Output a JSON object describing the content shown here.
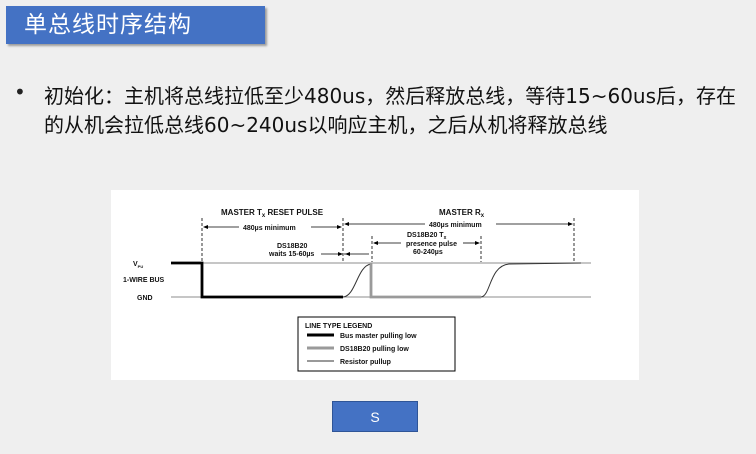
{
  "slide": {
    "title": "单总线时序结构",
    "bullet": "初始化：主机将总线拉低至少480us，然后释放总线，等待15~60us后，存在的从机会拉低总线60~240us以响应主机，之后从机将释放总线"
  },
  "diagram": {
    "master_tx_label": "MASTER T",
    "master_tx_sub": "x",
    "master_tx_suffix": " RESET PULSE",
    "master_tx_min": "480µs minimum",
    "master_rx_label": "MASTER R",
    "master_rx_sub": "x",
    "master_rx_min": "480µs minimum",
    "ds_wait_1": "DS18B20",
    "ds_wait_2": "waits 15-60µs",
    "ds_tx_label": "DS18B20 T",
    "ds_tx_sub": "x",
    "ds_presence_1": "presence pulse",
    "ds_presence_2": "60-240µs",
    "vpu_label": "V",
    "vpu_sub": "PU",
    "bus_label": "1-WIRE BUS",
    "gnd_label": "GND",
    "legend_title": "LINE TYPE LEGEND",
    "legend_items": [
      "Bus master pulling low",
      "DS18B20 pulling low",
      "Resistor pullup"
    ],
    "colors": {
      "master": "#000000",
      "slave": "#9a9a9a",
      "pullup": "#333333"
    }
  },
  "button": {
    "label": "S"
  },
  "theme": {
    "accent": "#4472c4",
    "background": "#efefef"
  }
}
